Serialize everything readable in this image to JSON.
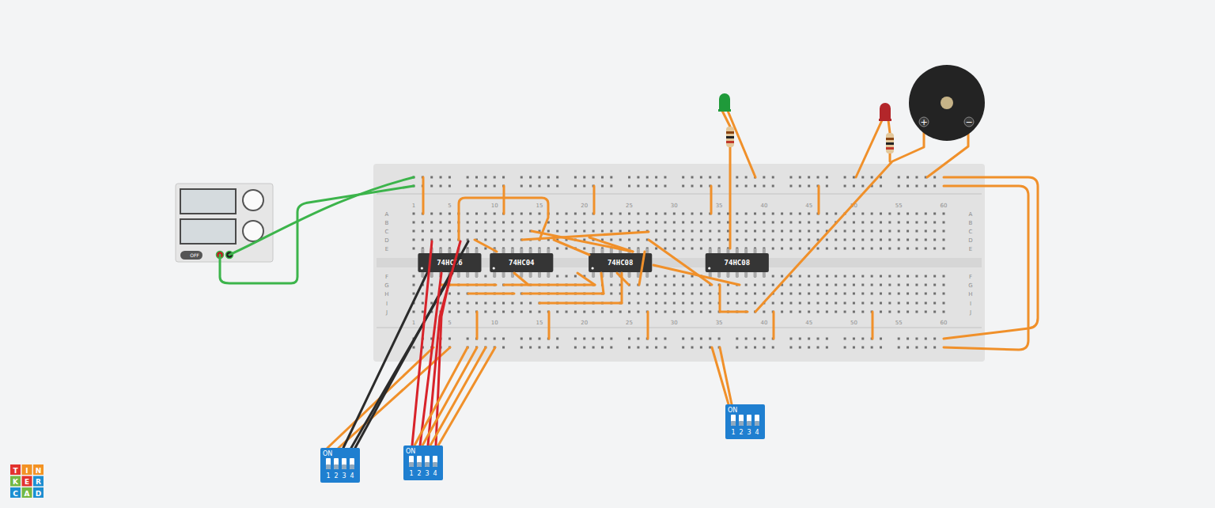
{
  "power_supply": {
    "switch_label": "OFF"
  },
  "breadboard": {
    "columns": [
      "1",
      "5",
      "10",
      "15",
      "20",
      "25",
      "30",
      "35",
      "40",
      "45",
      "50",
      "55",
      "60"
    ],
    "rows_top": [
      "A",
      "B",
      "C",
      "D",
      "E"
    ],
    "rows_bottom": [
      "F",
      "G",
      "H",
      "I",
      "J"
    ]
  },
  "chips": [
    {
      "label": "74HC86"
    },
    {
      "label": "74HC04"
    },
    {
      "label": "74HC08"
    },
    {
      "label": "74HC08"
    }
  ],
  "leds": [
    {
      "color": "#1f9a3a"
    },
    {
      "color": "#b3262a"
    }
  ],
  "buzzer": {
    "plus": "+",
    "minus": "−"
  },
  "dip_switches": [
    {
      "on_label": "ON",
      "switches": [
        {
          "label": "1",
          "on": false
        },
        {
          "label": "2",
          "on": false
        },
        {
          "label": "3",
          "on": false
        },
        {
          "label": "4",
          "on": false
        }
      ]
    },
    {
      "on_label": "ON",
      "switches": [
        {
          "label": "1",
          "on": false
        },
        {
          "label": "2",
          "on": false
        },
        {
          "label": "3",
          "on": false
        },
        {
          "label": "4",
          "on": false
        }
      ]
    },
    {
      "on_label": "ON",
      "switches": [
        {
          "label": "1",
          "on": false
        },
        {
          "label": "2",
          "on": false
        },
        {
          "label": "3",
          "on": false
        },
        {
          "label": "4",
          "on": false
        }
      ]
    }
  ],
  "logo": [
    {
      "letter": "T",
      "color": "#e2332e"
    },
    {
      "letter": "I",
      "color": "#f39224"
    },
    {
      "letter": "N",
      "color": "#f39224"
    },
    {
      "letter": "K",
      "color": "#74b843"
    },
    {
      "letter": "E",
      "color": "#e2332e"
    },
    {
      "letter": "R",
      "color": "#1d8fd1"
    },
    {
      "letter": "C",
      "color": "#1d8fd1"
    },
    {
      "letter": "A",
      "color": "#74b843"
    },
    {
      "letter": "D",
      "color": "#1d8fd1"
    }
  ]
}
